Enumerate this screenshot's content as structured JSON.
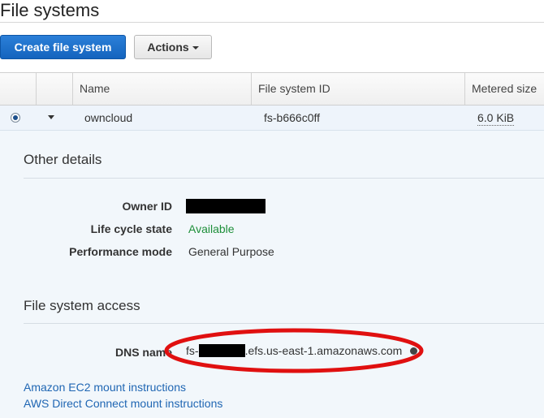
{
  "page": {
    "title": "File systems"
  },
  "toolbar": {
    "create_label": "Create file system",
    "actions_label": "Actions"
  },
  "table": {
    "columns": [
      "Name",
      "File system ID",
      "Metered size"
    ],
    "rows": [
      {
        "name": "owncloud",
        "file_system_id": "fs-b666c0ff",
        "metered_size": "6.0 KiB",
        "selected": true
      }
    ]
  },
  "details": {
    "other_details_title": "Other details",
    "owner_id_label": "Owner ID",
    "life_cycle_label": "Life cycle state",
    "life_cycle_value": "Available",
    "performance_label": "Performance mode",
    "performance_value": "General Purpose",
    "access_title": "File system access",
    "dns_label": "DNS name",
    "dns_prefix": "fs-",
    "dns_suffix": ".efs.us-east-1.amazonaws.com",
    "ec2_link": "Amazon EC2 mount instructions",
    "direct_connect_link": "AWS Direct Connect mount instructions"
  },
  "colors": {
    "primary_button": "#1f6fcb",
    "available_status": "#1e8f3a",
    "link": "#1f66b3",
    "annotation": "#e01010"
  }
}
